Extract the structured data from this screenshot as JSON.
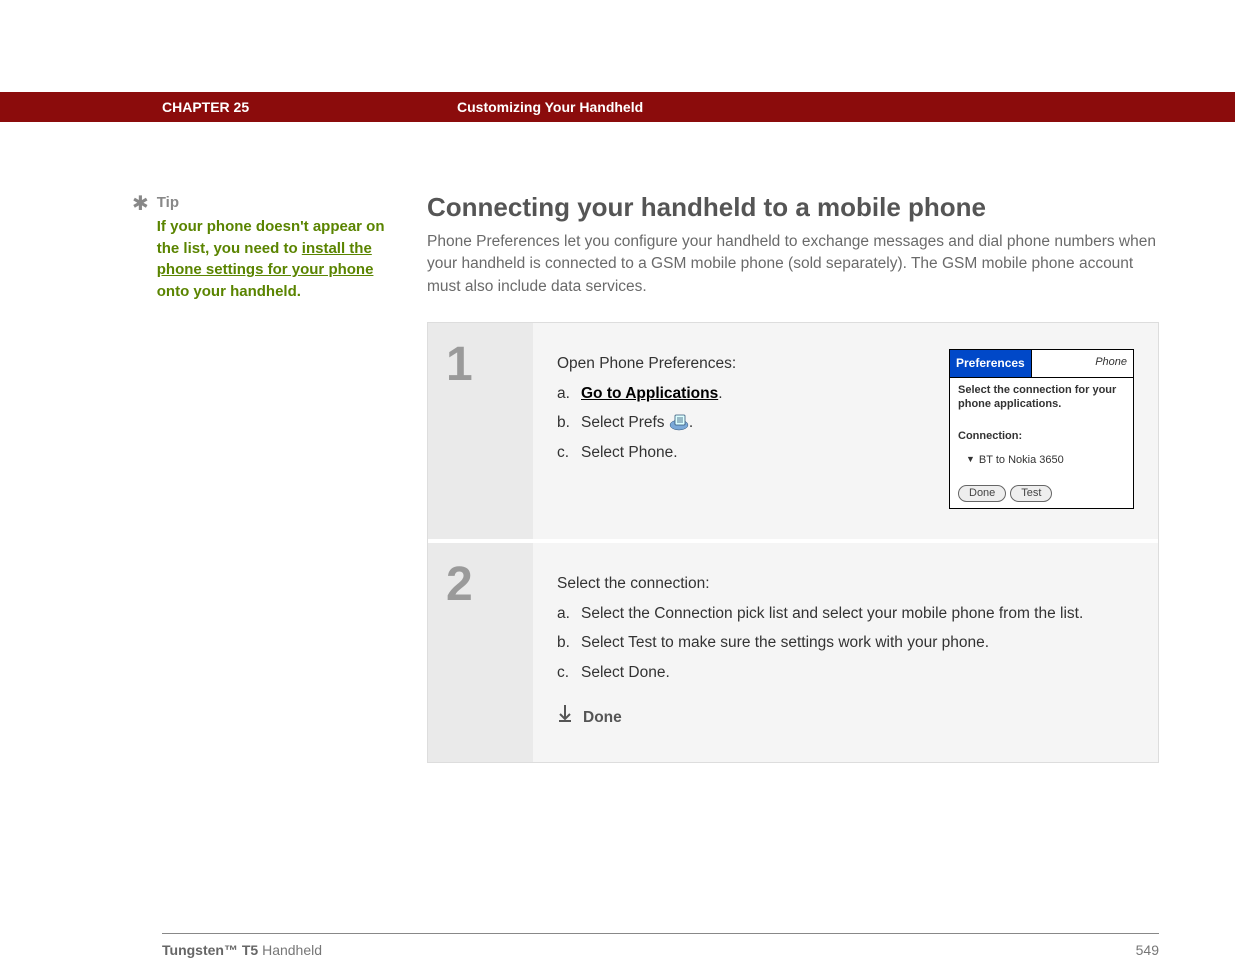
{
  "header": {
    "chapter": "CHAPTER 25",
    "title": "Customizing Your Handheld"
  },
  "sidebar": {
    "tipLabel": "Tip",
    "tipPre": "If your phone doesn't appear on the list, you need to ",
    "tipLink": "install the phone settings for your phone",
    "tipPost": " onto your handheld."
  },
  "main": {
    "heading": "Connecting your handheld to a mobile phone",
    "intro": "Phone Preferences let you configure your handheld to exchange messages and dial phone numbers when your handheld is connected to a GSM mobile phone (sold separately). The GSM mobile phone account must also include data services."
  },
  "step1": {
    "num": "1",
    "lead": "Open Phone Preferences:",
    "a_letter": "a.",
    "a_link": "Go to Applications",
    "a_post": ".",
    "b_letter": "b.",
    "b_pre": "Select Prefs ",
    "b_post": ".",
    "c_letter": "c.",
    "c_text": "Select Phone."
  },
  "palm": {
    "titleLeft": "Preferences",
    "titleRight": "Phone",
    "instruction": "Select the connection for your phone applications.",
    "connLabel": "Connection:",
    "connValue": "BT to Nokia 3650",
    "btnDone": "Done",
    "btnTest": "Test"
  },
  "step2": {
    "num": "2",
    "lead": "Select the connection:",
    "a_letter": "a.",
    "a_text": "Select the Connection pick list and select your mobile phone from the list.",
    "b_letter": "b.",
    "b_text": "Select Test to make sure the settings work with your phone.",
    "c_letter": "c.",
    "c_text": "Select Done.",
    "done": "Done"
  },
  "footer": {
    "productBold": "Tungsten™ T5",
    "productRest": " Handheld",
    "page": "549"
  }
}
